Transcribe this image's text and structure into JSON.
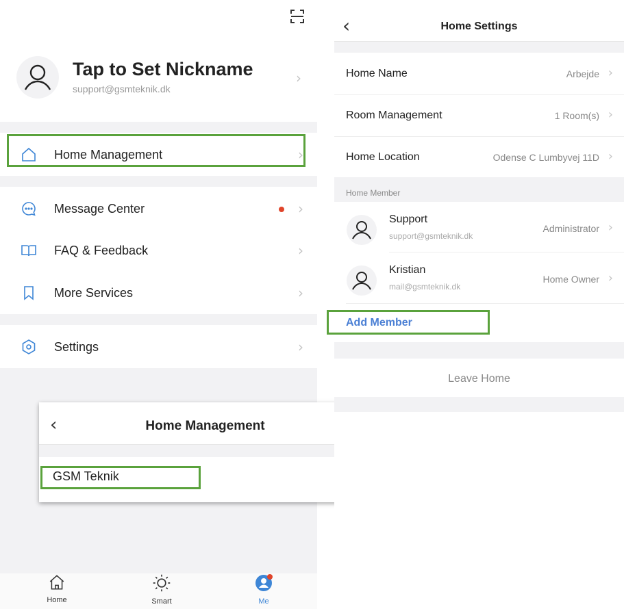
{
  "profile": {
    "title": "Tap to Set Nickname",
    "email": "support@gsmteknik.dk"
  },
  "menu": {
    "home_management": "Home Management",
    "message_center": "Message Center",
    "faq": "FAQ & Feedback",
    "more_services": "More Services",
    "settings": "Settings"
  },
  "bottom_nav": {
    "home": "Home",
    "smart": "Smart",
    "me": "Me"
  },
  "home_management_card": {
    "title": "Home Management",
    "item": "GSM Teknik"
  },
  "home_settings": {
    "title": "Home Settings",
    "rows": [
      {
        "key": "Home Name",
        "value": "Arbejde"
      },
      {
        "key": "Room Management",
        "value": "1 Room(s)"
      },
      {
        "key": "Home Location",
        "value": "Odense C Lumbyvej 11D"
      }
    ],
    "member_section": "Home Member",
    "members": [
      {
        "name": "Support",
        "email": "support@gsmteknik.dk",
        "role": "Administrator"
      },
      {
        "name": "Kristian",
        "email": "mail@gsmteknik.dk",
        "role": "Home Owner"
      }
    ],
    "add_member": "Add Member",
    "leave_home": "Leave Home"
  },
  "colors": {
    "highlight": "#5aa23c",
    "accent_blue": "#4a7fd4",
    "badge_red": "#e0442a",
    "icon_blue": "#3e86d6"
  }
}
